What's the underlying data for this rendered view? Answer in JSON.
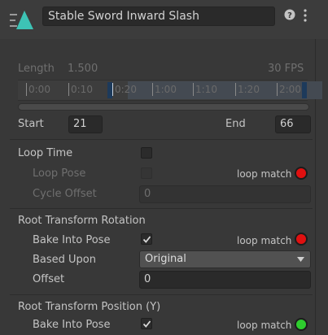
{
  "header": {
    "clip_name": "Stable Sword Inward Slash",
    "help_icon": "help-icon",
    "menu_icon": "kebab-menu-icon",
    "clip_icon": "animation-clip-icon"
  },
  "timeline": {
    "length_label": "Length",
    "length_value": "1.500",
    "fps": "30 FPS",
    "ticks": [
      "0:00",
      "0:10",
      "0:20",
      "1:00",
      "1:10",
      "1:20",
      "2:00"
    ]
  },
  "range": {
    "start_label": "Start",
    "start_value": "21",
    "end_label": "End",
    "end_value": "66"
  },
  "loop": {
    "loop_time_label": "Loop Time",
    "loop_time_checked": false,
    "loop_pose_label": "Loop Pose",
    "loop_pose_checked": false,
    "loop_match_label": "loop match",
    "cycle_offset_label": "Cycle Offset",
    "cycle_offset_value": "0"
  },
  "root_rotation": {
    "section_label": "Root Transform Rotation",
    "bake_label": "Bake Into Pose",
    "bake_checked": true,
    "loop_match_label": "loop match",
    "based_upon_label": "Based Upon",
    "based_upon_value": "Original",
    "offset_label": "Offset",
    "offset_value": "0"
  },
  "root_position_y": {
    "section_label": "Root Transform Position (Y)",
    "bake_label": "Bake Into Pose",
    "bake_checked": true,
    "loop_match_label": "loop match"
  },
  "colors": {
    "lamp_red": "#e01010",
    "lamp_green": "#2ecc2e",
    "icon_teal": "#3dc3b5"
  }
}
